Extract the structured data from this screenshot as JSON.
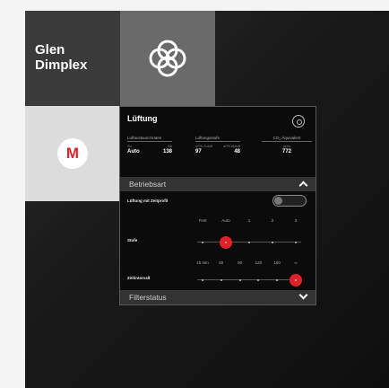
{
  "brand": {
    "line1": "Glen",
    "line2": "Dimplex"
  },
  "mode_tile": {
    "letter": "M"
  },
  "panel": {
    "title": "Lüftung",
    "stats": [
      {
        "heading": "Luftaustauschraten",
        "subs": [
          "Zu",
          "Ab"
        ],
        "values": [
          "Auto",
          "138"
        ]
      },
      {
        "heading": "Lüftungsstufe",
        "subs": [
          "m³/h Zuluft",
          "m³/h Abluft"
        ],
        "values": [
          "97",
          "48"
        ]
      },
      {
        "heading": "CO₂ Äquivalent",
        "subs": [
          "ppm"
        ],
        "values": [
          "772"
        ]
      }
    ],
    "section_betriebsart": "Betriebsart",
    "zeitprofil_label": "Lüftung mit Zeitprofil",
    "zeitprofil_on": false,
    "stufe": {
      "label": "Stufe",
      "ticks": [
        "Fest",
        "Auto",
        "1",
        "2",
        "3"
      ],
      "selected": "Auto"
    },
    "zeitintervall": {
      "label": "Zeitintervall",
      "ticks": [
        "15 min",
        "60",
        "90",
        "120",
        "180",
        "∞"
      ],
      "selected": "∞"
    },
    "section_filterstatus": "Filterstatus"
  },
  "colors": {
    "accent": "#e0202a",
    "panel_bg": "#0b0b0b"
  }
}
